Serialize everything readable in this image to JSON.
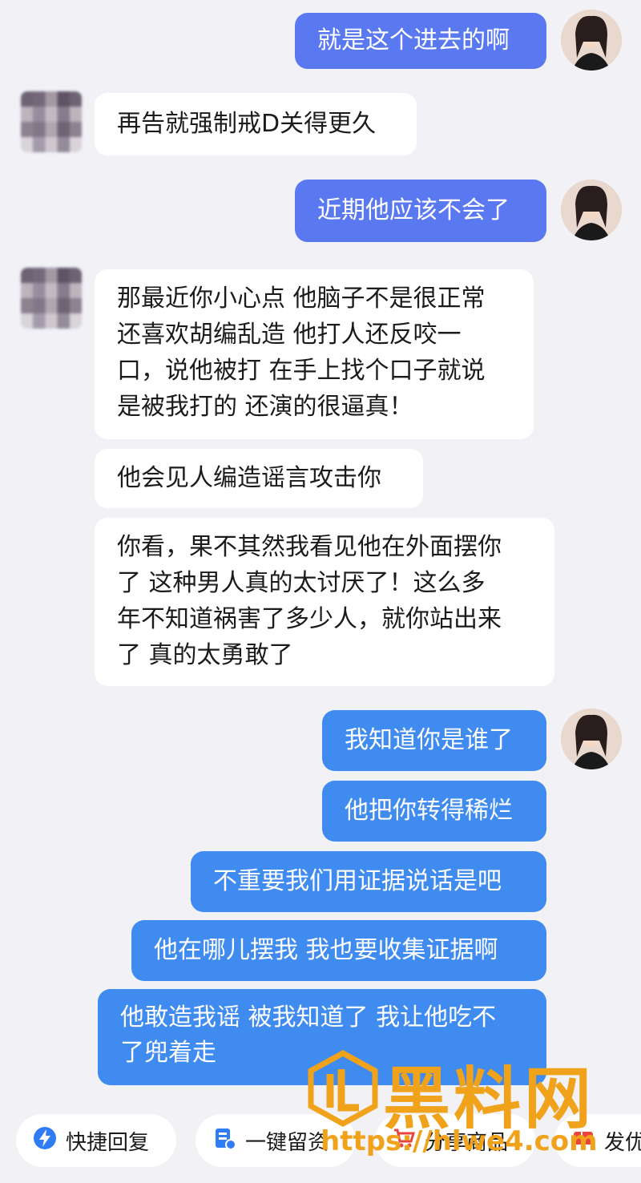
{
  "messages": [
    {
      "side": "out",
      "text": "就是这个进去的啊"
    },
    {
      "side": "in",
      "text": "再告就强制戒D关得更久"
    },
    {
      "side": "out",
      "text": "近期他应该不会了"
    },
    {
      "side": "in",
      "lines": [
        "那最近你小心点 他脑子不是很正常",
        "还喜欢胡编乱造 他打人还反咬一",
        "口，说他被打 在手上找个口子就说",
        "是被我打的 还演的很逼真！"
      ]
    },
    {
      "side": "in",
      "text": "他会见人编造谣言攻击你"
    },
    {
      "side": "in",
      "lines": [
        "你看，果不其然我看见他在外面摆你",
        "了 这种男人真的太讨厌了！这么多",
        "年不知道祸害了多少人，就你站出来",
        "了 真的太勇敢了"
      ]
    },
    {
      "side": "out",
      "text": "我知道你是谁了"
    },
    {
      "side": "out",
      "text": "他把你转得稀烂"
    },
    {
      "side": "out",
      "text": "不重要我们用证据说话是吧"
    },
    {
      "side": "out",
      "text": "他在哪儿摆我 我也要收集证据啊"
    },
    {
      "side": "out",
      "lines": [
        "他敢造我谣 被我知道了 我让他吃不",
        "了兜着走"
      ]
    }
  ],
  "bottom_bar": {
    "quick_reply": "快捷回复",
    "leave_info": "一键留资",
    "share_product": "分享商品",
    "send": "发优"
  },
  "watermark": {
    "title": "黑料网",
    "url": "https://hlwe4.com"
  },
  "colors": {
    "out_bubble": "#5a79f0",
    "in_bubble": "#ffffff",
    "background": "#f1f1f6",
    "watermark": "#f1a21b"
  }
}
